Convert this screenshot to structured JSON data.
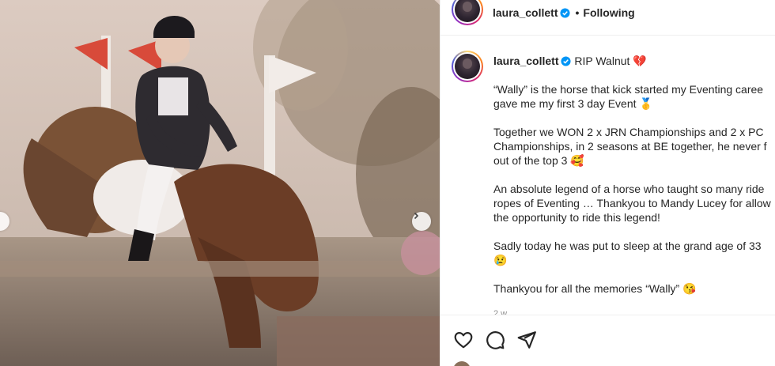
{
  "header": {
    "username": "laura_collett",
    "separator": "•",
    "follow_status": "Following"
  },
  "caption": {
    "username": "laura_collett",
    "title": "RIP Walnut 💔",
    "paragraphs": [
      [
        "“Wally” is the horse that kick started my Eventing caree",
        "gave me my first 3 day Event 🥇"
      ],
      [
        "Together we WON 2 x JRN Championships and 2 x PC",
        "Championships, in 2 seasons at BE together, he never f",
        "out of the top 3 🥰"
      ],
      [
        "An absolute legend of a horse who taught so many ride",
        "ropes of Eventing … Thankyou to Mandy Lucey for allow",
        "the opportunity to ride this legend!"
      ],
      [
        "Sadly today he was put to sleep at the grand age of 33",
        "😢"
      ],
      [
        "Thankyou for all the memories “Wally” 😘"
      ]
    ],
    "timestamp": "2 w"
  },
  "photo": {
    "description_icon": "horse-jump-photo",
    "carousel_next": "chevron-right-icon",
    "carousel_prev": "chevron-left-icon"
  },
  "actions": {
    "like_icon": "heart-icon",
    "comment_icon": "comment-icon",
    "share_icon": "paper-plane-icon"
  },
  "colors": {
    "verified": "#0095f6",
    "text": "#262626",
    "muted": "#8e8e8e",
    "border": "#efefef"
  }
}
